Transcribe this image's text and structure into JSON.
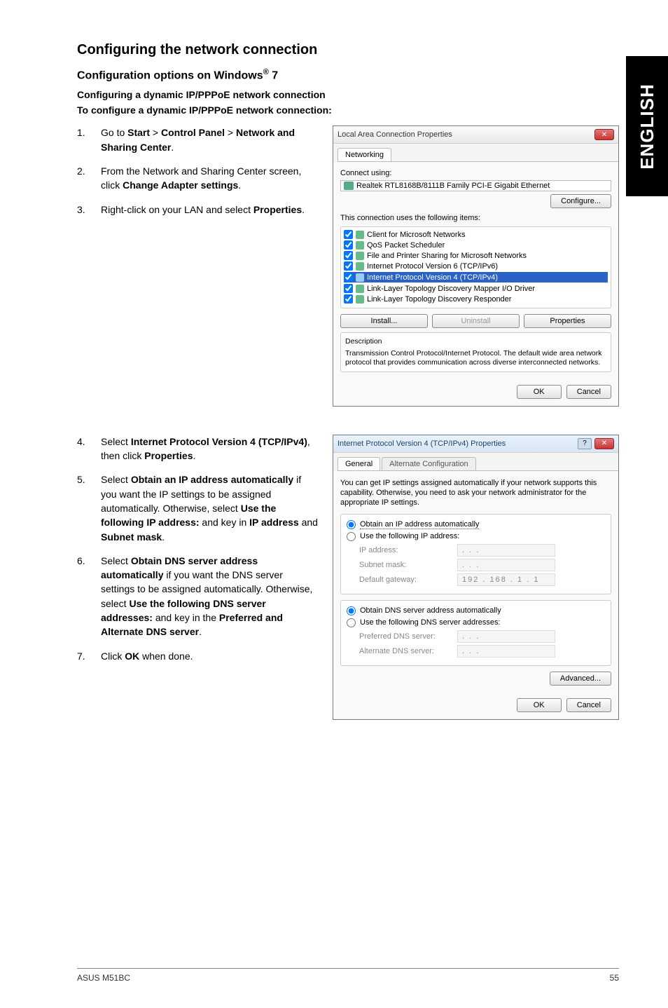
{
  "sideTab": "ENGLISH",
  "headings": {
    "main": "Configuring the network connection",
    "sub": "Configuration options on Windows",
    "subSup": "®",
    "subTrail": " 7",
    "bold1": "Configuring a dynamic IP/PPPoE network connection",
    "bold2": "To configure a dynamic IP/PPPoE network connection:"
  },
  "stepsA": [
    {
      "n": "1.",
      "html": "Go to <b>Start</b> > <b>Control Panel</b> > <b>Network and Sharing Center</b>."
    },
    {
      "n": "2.",
      "html": "From the Network and Sharing Center screen, click <b>Change Adapter settings</b>."
    },
    {
      "n": "3.",
      "html": "Right-click on your LAN and select <b>Properties</b>."
    }
  ],
  "stepsB": [
    {
      "n": "4.",
      "html": "Select <b>Internet Protocol Version 4 (TCP/IPv4)</b>, then click <b>Properties</b>."
    },
    {
      "n": "5.",
      "html": "Select <b>Obtain an IP address automatically</b> if you want the IP settings to be assigned automatically. Otherwise, select <b>Use the following IP address:</b> and key in <b>IP address</b> and <b>Subnet mask</b>."
    },
    {
      "n": "6.",
      "html": "Select <b>Obtain DNS server address automatically</b> if you want the DNS server settings to be assigned automatically. Otherwise, select <b>Use the following DNS server addresses:</b> and key in the <b>Preferred and Alternate DNS server</b>."
    },
    {
      "n": "7.",
      "html": "Click <b>OK</b> when done."
    }
  ],
  "dlg1": {
    "title": "Local Area Connection Properties",
    "tab": "Networking",
    "connectUsing": "Connect using:",
    "adapter": "Realtek RTL8168B/8111B Family PCI-E Gigabit Ethernet",
    "configure": "Configure...",
    "listLabel": "This connection uses the following items:",
    "items": [
      {
        "label": "Client for Microsoft Networks",
        "sel": false
      },
      {
        "label": "QoS Packet Scheduler",
        "sel": false
      },
      {
        "label": "File and Printer Sharing for Microsoft Networks",
        "sel": false
      },
      {
        "label": "Internet Protocol Version 6 (TCP/IPv6)",
        "sel": false
      },
      {
        "label": "Internet Protocol Version 4 (TCP/IPv4)",
        "sel": true
      },
      {
        "label": "Link-Layer Topology Discovery Mapper I/O Driver",
        "sel": false
      },
      {
        "label": "Link-Layer Topology Discovery Responder",
        "sel": false
      }
    ],
    "install": "Install...",
    "uninstall": "Uninstall",
    "properties": "Properties",
    "descTitle": "Description",
    "desc": "Transmission Control Protocol/Internet Protocol. The default wide area network protocol that provides communication across diverse interconnected networks.",
    "ok": "OK",
    "cancel": "Cancel"
  },
  "dlg2": {
    "title": "Internet Protocol Version 4 (TCP/IPv4) Properties",
    "tabs": {
      "a": "General",
      "b": "Alternate Configuration"
    },
    "para": "You can get IP settings assigned automatically if your network supports this capability. Otherwise, you need to ask your network administrator for the appropriate IP settings.",
    "r1": "Obtain an IP address automatically",
    "r2": "Use the following IP address:",
    "ipaddr": "IP address:",
    "subnet": "Subnet mask:",
    "gateway": "Default gateway:",
    "gatewayVal": "192 . 168 .  1  .  1",
    "r3": "Obtain DNS server address automatically",
    "r4": "Use the following DNS server addresses:",
    "pref": "Preferred DNS server:",
    "alt": "Alternate DNS server:",
    "dots": ".      .      .",
    "advanced": "Advanced...",
    "ok": "OK",
    "cancel": "Cancel"
  },
  "footer": {
    "left": "ASUS M51BC",
    "right": "55"
  }
}
